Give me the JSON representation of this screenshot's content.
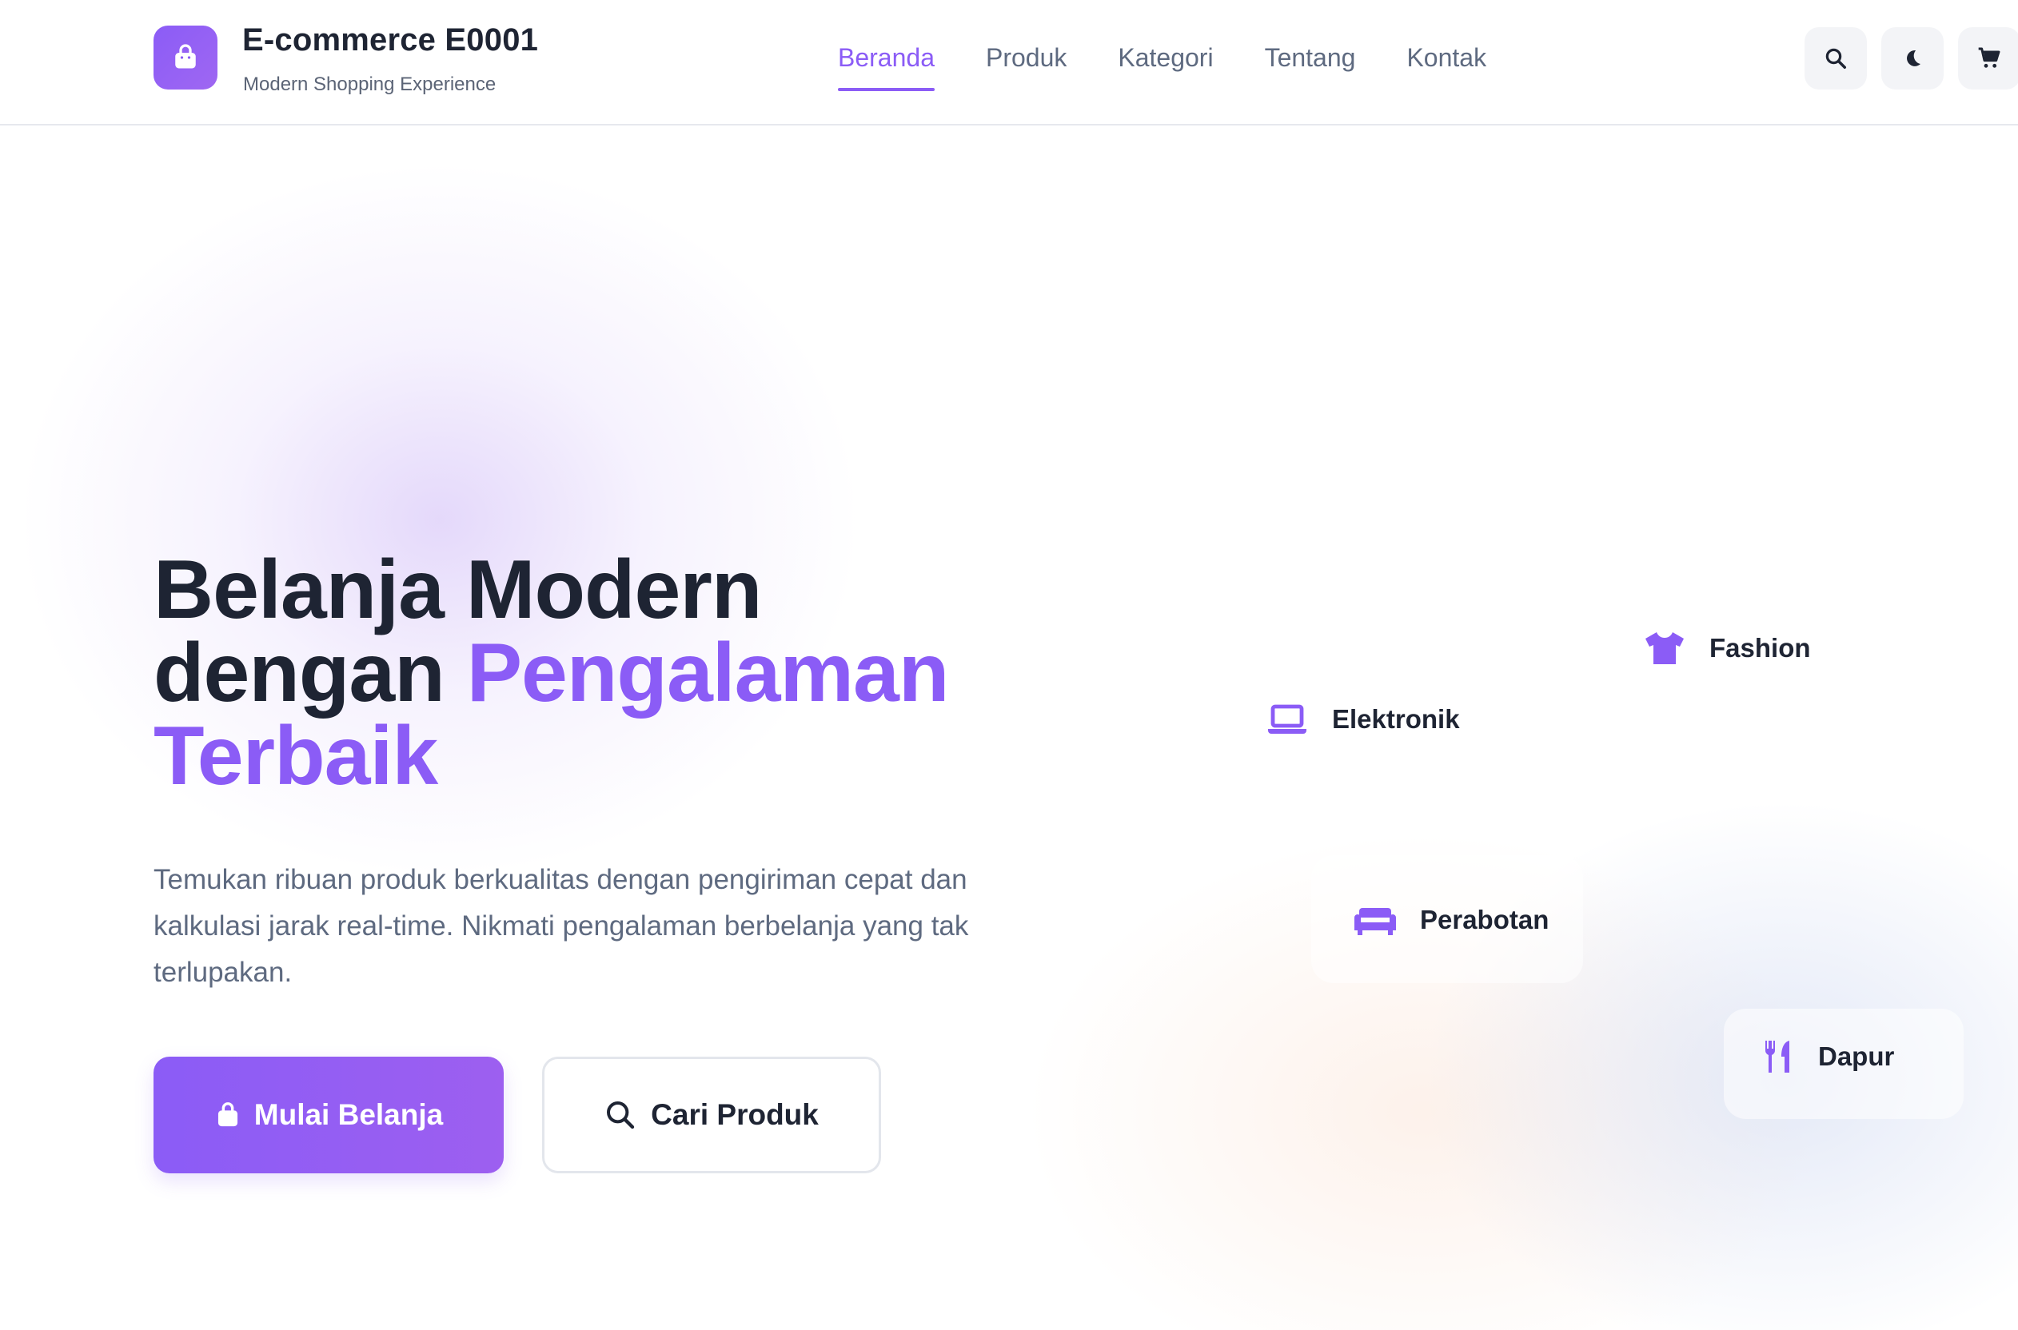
{
  "header": {
    "brand_title": "E-commerce E0001",
    "brand_subtitle": "Modern Shopping Experience",
    "nav": [
      {
        "label": "Beranda",
        "active": true
      },
      {
        "label": "Produk",
        "active": false
      },
      {
        "label": "Kategori",
        "active": false
      },
      {
        "label": "Tentang",
        "active": false
      },
      {
        "label": "Kontak",
        "active": false
      }
    ],
    "actions": [
      "search-icon",
      "moon-icon",
      "cart-icon"
    ]
  },
  "hero": {
    "title_line1": "Belanja Modern",
    "title_line2_plain": "dengan ",
    "title_line2_accent": "Pengalaman",
    "title_line3_accent": "Terbaik",
    "description": "Temukan ribuan produk berkualitas dengan pengiriman cepat dan kalkulasi jarak real-time. Nikmati pengalaman berbelanja yang tak terlupakan.",
    "primary_button": "Mulai Belanja",
    "secondary_button": "Cari Produk"
  },
  "categories": [
    {
      "label": "Fashion",
      "icon": "shirt-icon"
    },
    {
      "label": "Elektronik",
      "icon": "laptop-icon"
    },
    {
      "label": "Perabotan",
      "icon": "sofa-icon"
    },
    {
      "label": "Dapur",
      "icon": "utensils-icon"
    }
  ],
  "colors": {
    "accent": "#8b5cf6",
    "text_dark": "#1e2433",
    "text_muted": "#5e6a80"
  }
}
